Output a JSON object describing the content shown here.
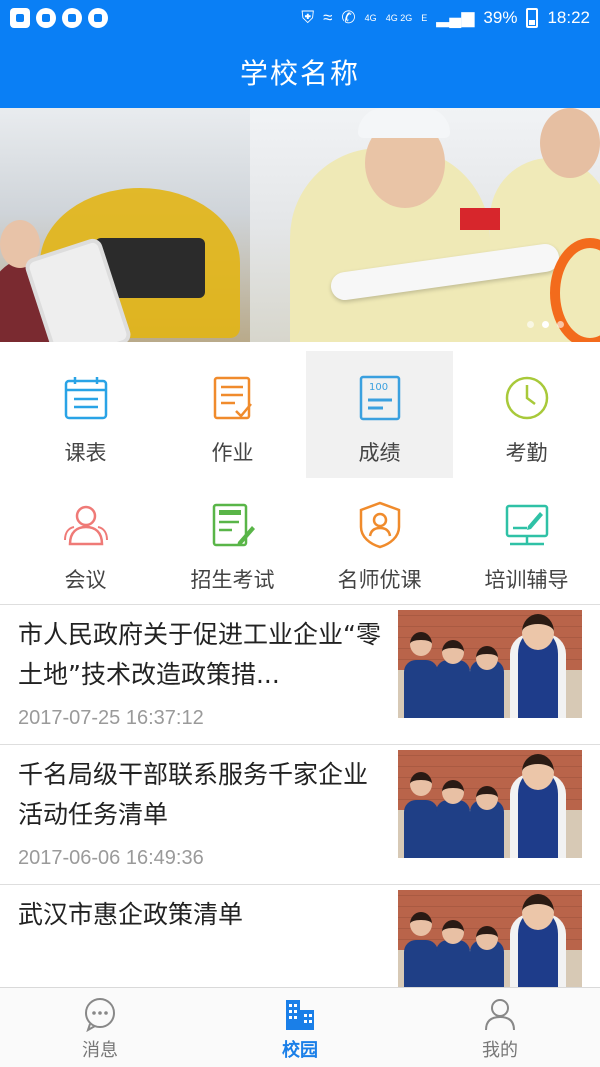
{
  "status_bar": {
    "network_small_top": "4G",
    "network_small_stack": "4G 2G",
    "network_e": "E",
    "battery": "39%",
    "time": "18:22"
  },
  "header": {
    "title": "学校名称"
  },
  "banner": {
    "slide_count": 3,
    "active_index": 1
  },
  "menu": {
    "items": [
      {
        "label": "课表",
        "icon": "calendar-icon",
        "color": "#29a3e6"
      },
      {
        "label": "作业",
        "icon": "checklist-icon",
        "color": "#f08b2c"
      },
      {
        "label": "成绩",
        "icon": "score-icon",
        "color": "#3aa0df"
      },
      {
        "label": "考勤",
        "icon": "clock-icon",
        "color": "#a8c93a"
      },
      {
        "label": "会议",
        "icon": "people-icon",
        "color": "#ef7a77"
      },
      {
        "label": "招生考试",
        "icon": "exam-icon",
        "color": "#59b548"
      },
      {
        "label": "名师优课",
        "icon": "teacher-badge-icon",
        "color": "#f08b2c"
      },
      {
        "label": "培训辅导",
        "icon": "training-icon",
        "color": "#2fc1a6"
      }
    ]
  },
  "news": [
    {
      "title": "市人民政府关于促进工业企业“零土地”技术改造政策措...",
      "date": "2017-07-25 16:37:12"
    },
    {
      "title": "千名局级干部联系服务千家企业活动任务清单",
      "date": "2017-06-06 16:49:36"
    },
    {
      "title": "武汉市惠企政策清单",
      "date": ""
    }
  ],
  "tabs": [
    {
      "label": "消息",
      "icon": "message-icon",
      "active": false
    },
    {
      "label": "校园",
      "icon": "campus-icon",
      "active": true
    },
    {
      "label": "我的",
      "icon": "profile-icon",
      "active": false
    }
  ],
  "colors": {
    "primary": "#0a7ff5",
    "tab_active": "#1a7fe8"
  }
}
